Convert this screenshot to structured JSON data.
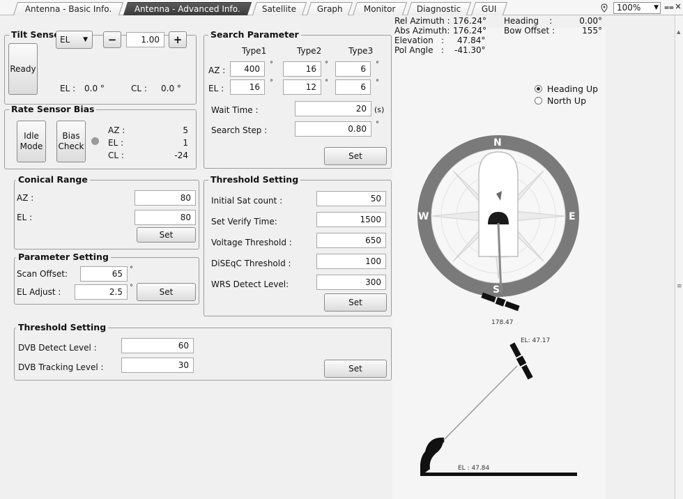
{
  "tabs": [
    {
      "label": "Antenna - Basic Info."
    },
    {
      "label": "Antenna - Advanced Info."
    },
    {
      "label": "Satellite"
    },
    {
      "label": "Graph"
    },
    {
      "label": "Monitor"
    },
    {
      "label": "Diagnostic"
    },
    {
      "label": "GUI"
    }
  ],
  "active_tab": "Antenna - Advanced Info.",
  "zoom": {
    "value": "100%"
  },
  "tilt": {
    "title": "Tilt Sensor Bias",
    "ready_label": "Ready",
    "axis_select": "EL",
    "minus": "−",
    "plus": "+",
    "value": "1.00",
    "el_label": "EL :",
    "el_value": "0.0 °",
    "cl_label": "CL :",
    "cl_value": "0.0 °"
  },
  "rate": {
    "title": "Rate Sensor Bias",
    "idle_label": "Idle Mode",
    "bias_label": "Bias Check",
    "az_label": "AZ :",
    "az_value": "5",
    "el_label": "EL :",
    "el_value": "1",
    "cl_label": "CL :",
    "cl_value": "-24"
  },
  "search": {
    "title": "Search Parameter",
    "col1": "Type1",
    "col2": "Type2",
    "col3": "Type3",
    "az_label": "AZ :",
    "el_label": "EL :",
    "az": [
      "400",
      "16",
      "6"
    ],
    "el": [
      "16",
      "12",
      "6"
    ],
    "wait_label": "Wait Time :",
    "wait_value": "20",
    "wait_unit": "(s)",
    "step_label": "Search Step :",
    "step_value": "0.80",
    "set_label": "Set",
    "deg": "°"
  },
  "conical": {
    "title": "Conical Range",
    "az_label": "AZ :",
    "az_value": "80",
    "el_label": "EL :",
    "el_value": "80",
    "set_label": "Set"
  },
  "threshold1": {
    "title": "Threshold Setting",
    "rows": [
      {
        "label": "Initial Sat count :",
        "value": "50"
      },
      {
        "label": "Set Verify Time:",
        "value": "1500"
      },
      {
        "label": "Voltage Threshold :",
        "value": "650"
      },
      {
        "label": "DiSEqC Threshold :",
        "value": "100"
      },
      {
        "label": "WRS Detect Level:",
        "value": "300"
      }
    ],
    "set_label": "Set"
  },
  "param": {
    "title": "Parameter Setting",
    "scan_label": "Scan Offset:",
    "scan_value": "65",
    "el_label": "EL Adjust :",
    "el_value": "2.5",
    "set_label": "Set"
  },
  "threshold2": {
    "title": "Threshold Setting",
    "dvb_detect_label": "DVB Detect Level :",
    "dvb_detect_value": "60",
    "dvb_track_label": "DVB Tracking Level :",
    "dvb_track_value": "30",
    "set_label": "Set"
  },
  "info": {
    "rel_az_label": "Rel Azimuth :",
    "rel_az_value": "176.24°",
    "abs_az_label": "Abs Azimuth:",
    "abs_az_value": "176.24°",
    "elev_label": "Elevation   :",
    "elev_value": "47.84°",
    "pol_label": "Pol Angle   :",
    "pol_value": "-41.30°",
    "heading_label": "Heading    :",
    "heading_value": "0.00°",
    "bow_label": "Bow Offset :",
    "bow_value": "155°"
  },
  "orientation": {
    "heading_up": "Heading Up",
    "north_up": "North Up",
    "selected": "Heading Up"
  },
  "compass": {
    "n": "N",
    "e": "E",
    "s": "S",
    "w": "W",
    "sat_azimuth_label": "178.47",
    "relative_azimuth_deg": 176.24
  },
  "elevation_view": {
    "sat_label": "EL: 47.17",
    "antenna_label": "EL : 47.84",
    "elevation_deg": 47.84
  },
  "colors": {
    "active_tab": "#3f3f3f",
    "compass_ring": "#7a7a7a",
    "ship": "#ffffff"
  }
}
